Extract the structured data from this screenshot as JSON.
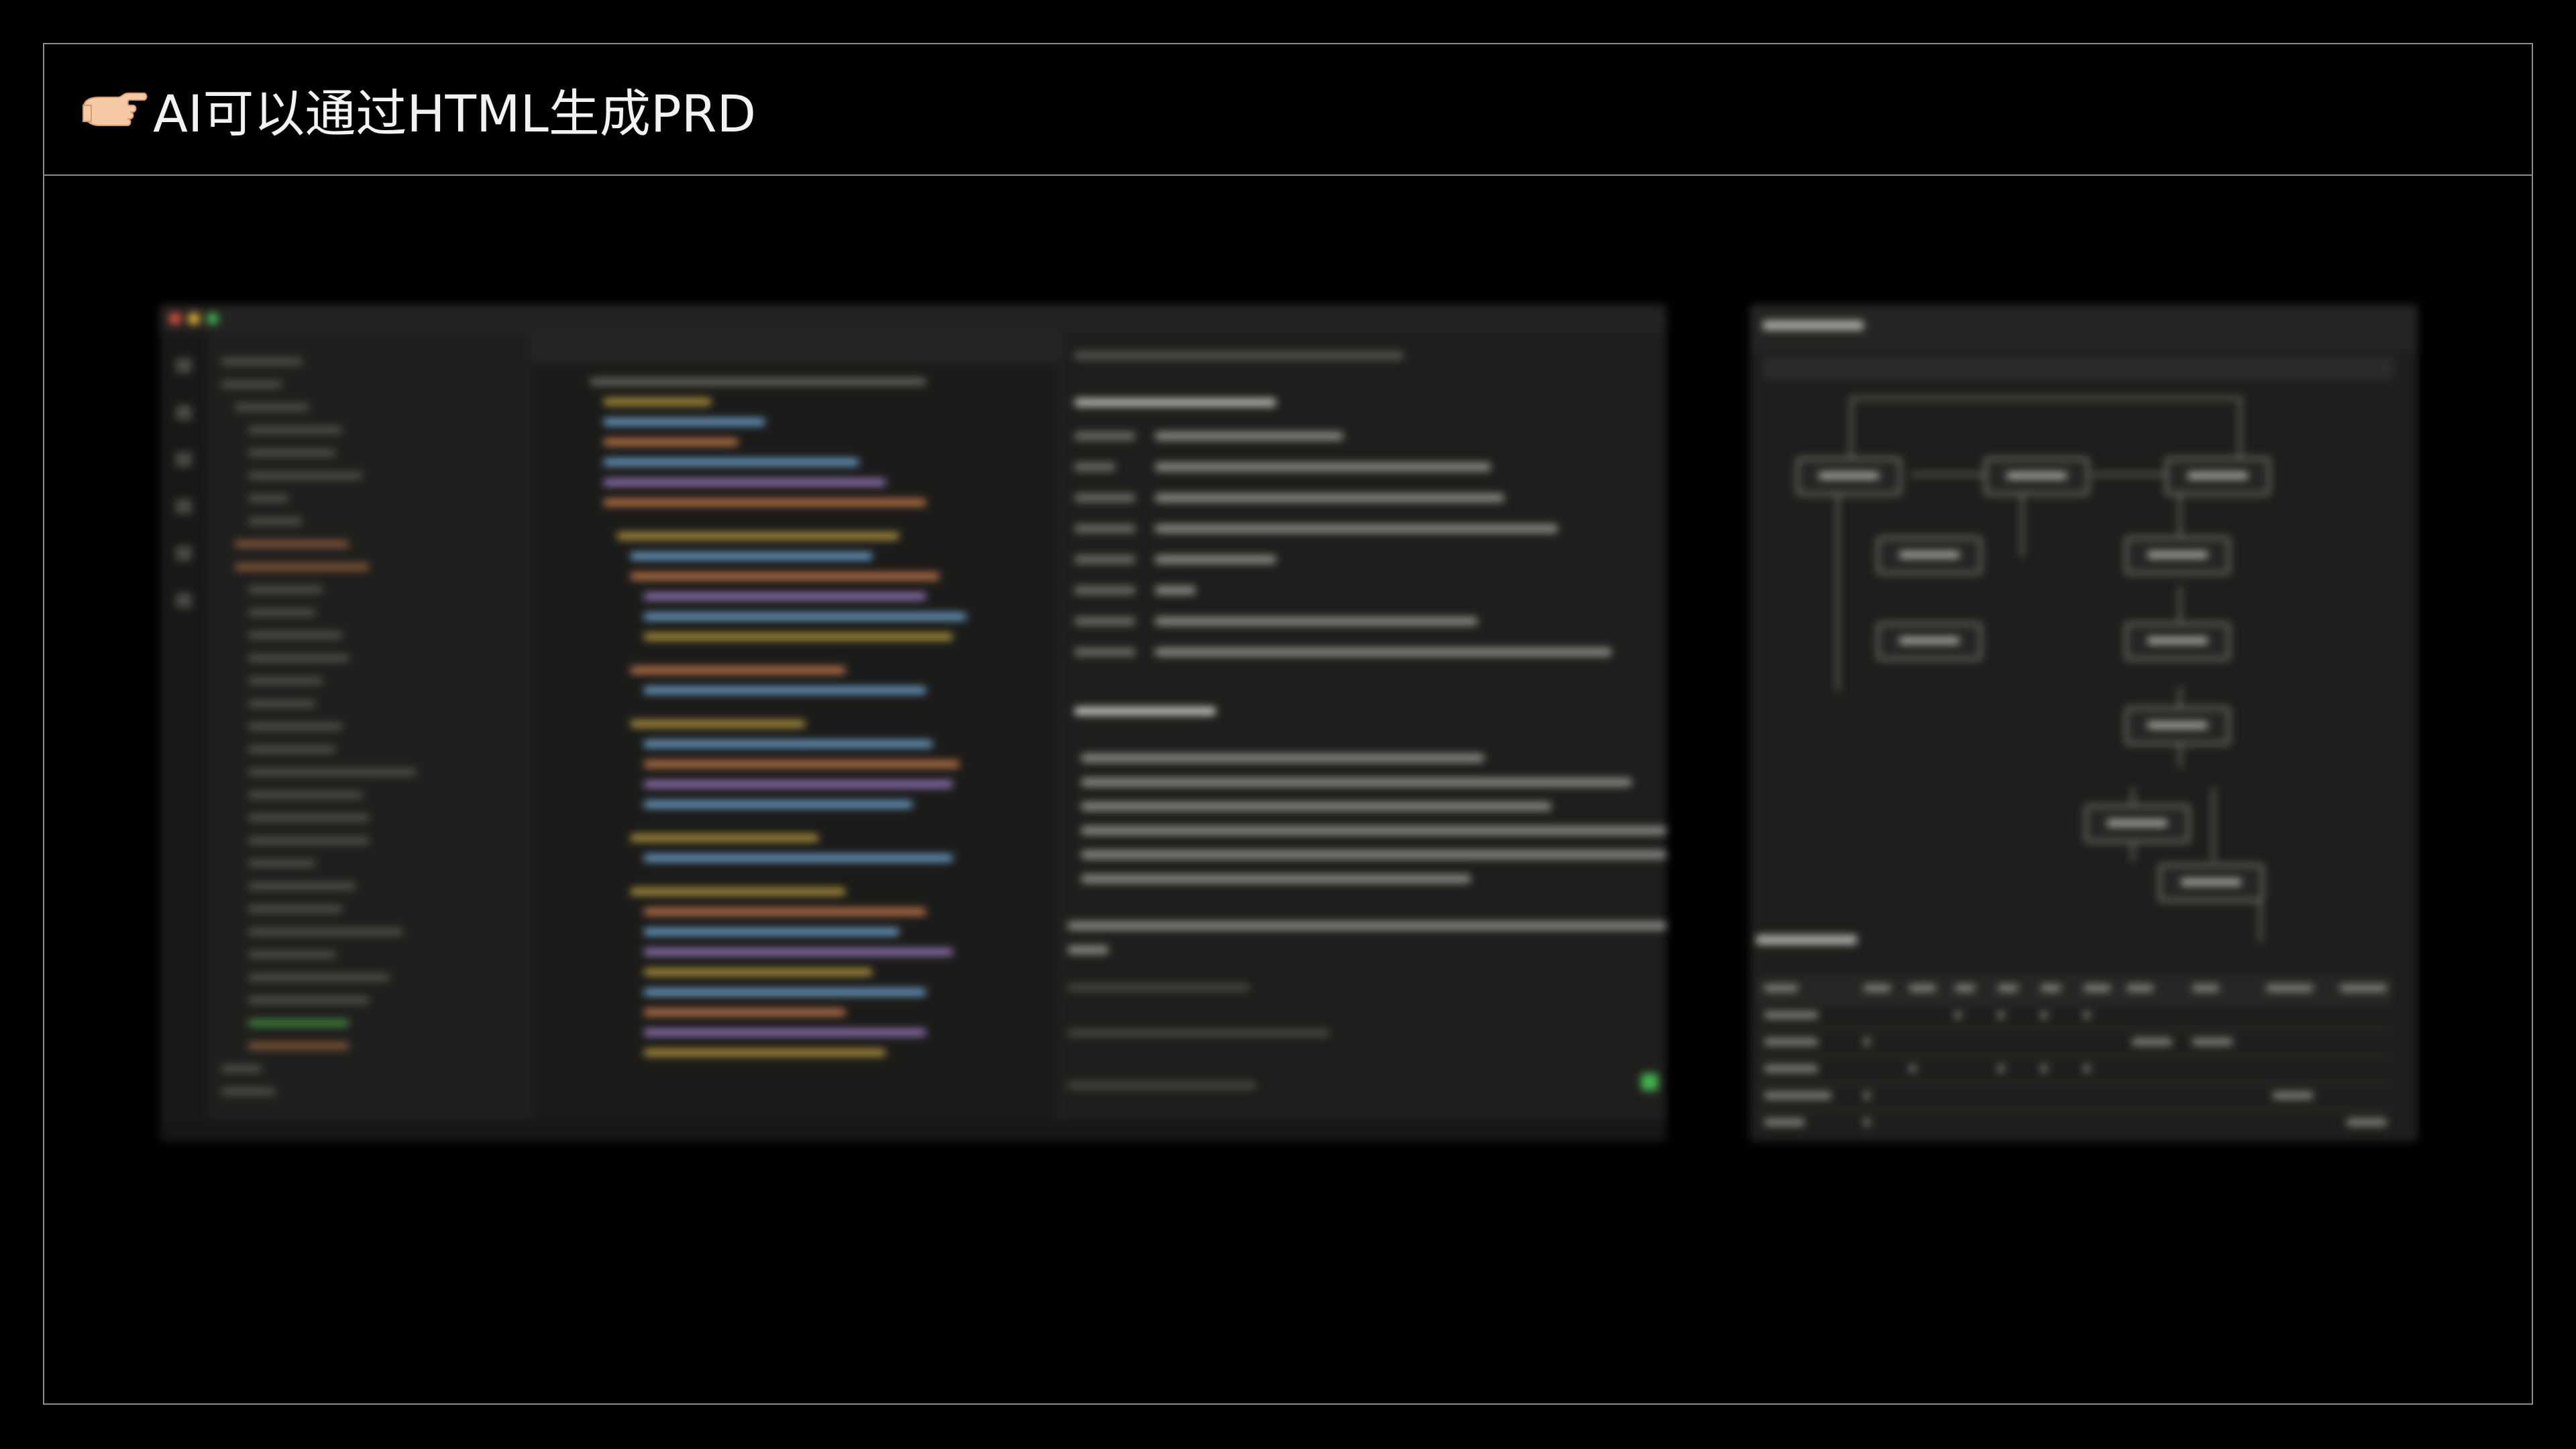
{
  "slide": {
    "title": "AI可以通过HTML生成PRD",
    "title_icon": "backhand-index-pointing-right-emoji"
  },
  "screenshots": [
    {
      "name": "ide-screenshot",
      "description_visible": "blurred",
      "accent_colors": [
        "#e5533d",
        "#e6b33a",
        "#43b34f"
      ]
    },
    {
      "name": "flowchart-screenshot",
      "description_visible": "blurred"
    }
  ],
  "colors": {
    "background": "#000000",
    "frame_border": "#8c8c8c",
    "title_text": "#f2f2f2"
  }
}
